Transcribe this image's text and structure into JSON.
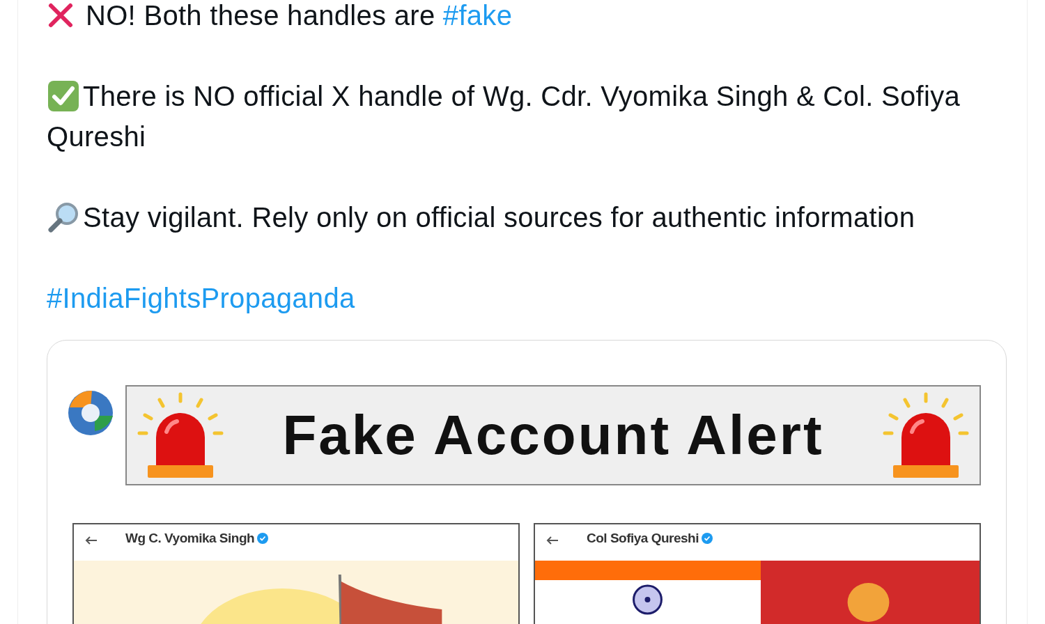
{
  "post": {
    "paragraphs": [
      {
        "kind": "cross",
        "parts": [
          {
            "kind": "text",
            "text": "NO! Both these handles are "
          },
          {
            "kind": "hashtag",
            "text": "#fake"
          }
        ]
      },
      {
        "kind": "check",
        "parts": [
          {
            "kind": "text",
            "text": "There is NO official X handle of Wg. Cdr. Vyomika Singh & Col. Sofiya Qureshi"
          }
        ]
      },
      {
        "kind": "magnifier",
        "parts": [
          {
            "kind": "text",
            "text": "Stay vigilant. Rely only on official sources for authentic information"
          }
        ]
      },
      {
        "kind": "hashtags",
        "parts": [
          {
            "kind": "hashtag",
            "text": "#IndiaFightsPropaganda"
          }
        ]
      }
    ]
  },
  "image": {
    "banner_title": "Fake Account Alert",
    "profiles": [
      {
        "name": "Wg C. Vyomika Singh",
        "verified": true,
        "kind": "sunrise"
      },
      {
        "name": "Col Sofiya Qureshi",
        "verified": true,
        "kind": "flag"
      }
    ]
  }
}
